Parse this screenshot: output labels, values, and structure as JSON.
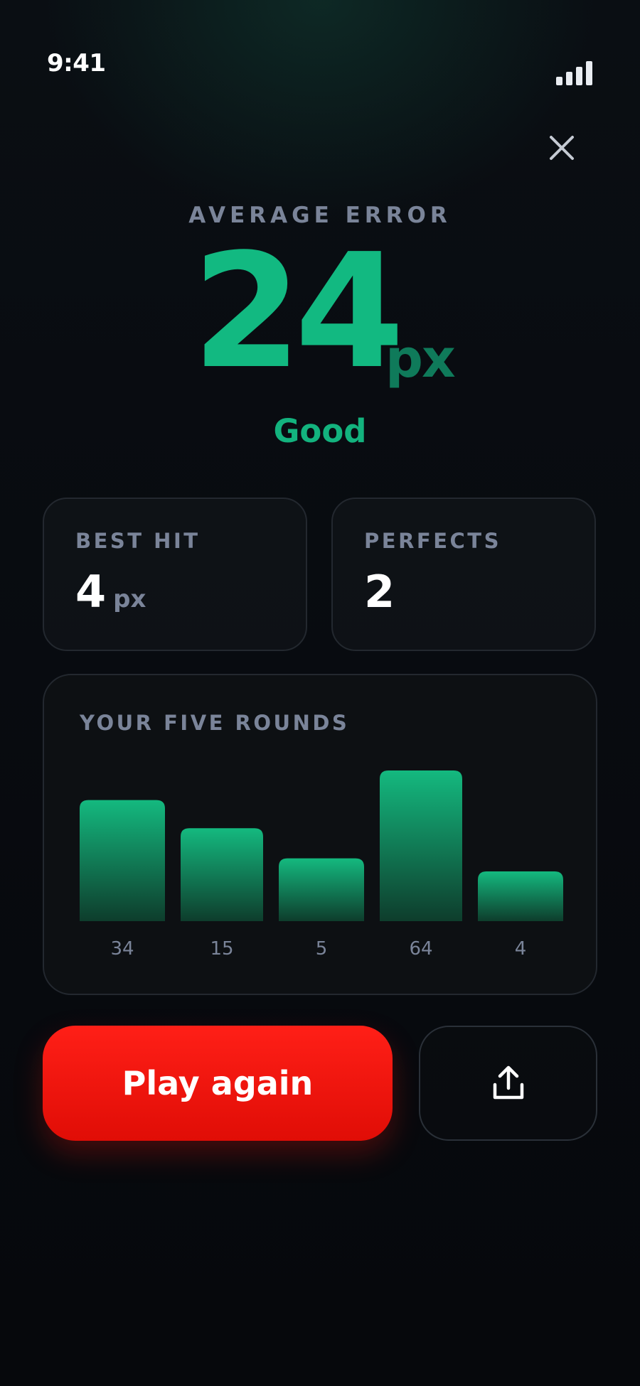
{
  "status_bar": {
    "time": "9:41",
    "signal_icon": "cellular-signal-icon"
  },
  "header": {
    "close_icon": "close-icon"
  },
  "result": {
    "label": "AVERAGE ERROR",
    "value": "24",
    "unit": "px",
    "rating": "Good"
  },
  "stats": {
    "best_hit": {
      "label": "BEST HIT",
      "value": "4",
      "unit": "px"
    },
    "perfects": {
      "label": "PERFECTS",
      "value": "2"
    }
  },
  "rounds": {
    "title": "YOUR FIVE ROUNDS"
  },
  "chart_data": {
    "type": "bar",
    "title": "YOUR FIVE ROUNDS",
    "categories": [
      "34",
      "15",
      "5",
      "64",
      "4"
    ],
    "values": [
      34,
      15,
      5,
      64,
      4
    ],
    "xlabel": "",
    "ylabel": "",
    "grid": false,
    "colors": {
      "bar_top": "#14b97f",
      "bar_bottom": "#0e3d2c",
      "tick_label": "#7a8499"
    }
  },
  "actions": {
    "play_again_label": "Play again",
    "share_icon": "share-icon"
  },
  "colors": {
    "accent": "#12b981",
    "accent_dim": "#0f7a5a",
    "primary_button": "#f51610",
    "muted_text": "#7a8499",
    "background": "#07090e"
  }
}
